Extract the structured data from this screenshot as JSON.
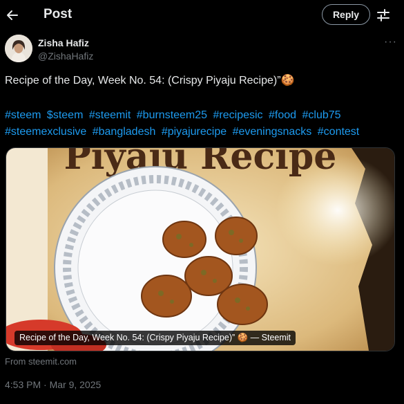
{
  "header": {
    "title": "Post",
    "reply_label": "Reply"
  },
  "icons": {
    "back": "back-arrow-icon",
    "tune": "tune-icon",
    "more": "more-icon"
  },
  "author": {
    "name": "Zisha Hafiz",
    "handle": "@ZishaHafiz",
    "more_glyph": "···"
  },
  "post": {
    "text": "Recipe of the Day, Week No. 54: (Crispy Piyaju Recipe)”🍪",
    "hashtags": [
      "#steem",
      "$steem",
      "#steemit",
      "#burnsteem25",
      "#recipesic",
      "#food",
      "#club75",
      "#steemexclusive",
      "#bangladesh",
      "#piyajurecipe",
      "#eveningsnacks",
      "#contest"
    ]
  },
  "card": {
    "image_heading": "Piyaju Recipe",
    "caption": "Recipe of the Day, Week No. 54: (Crispy Piyaju Recipe)” 🍪 — Steemit",
    "source": "From steemit.com"
  },
  "meta": {
    "timestamp": "4:53 PM · Mar 9, 2025"
  },
  "colors": {
    "link": "#1d9bf0",
    "muted": "#71767b",
    "text": "#e7e9ea",
    "background": "#000000"
  }
}
